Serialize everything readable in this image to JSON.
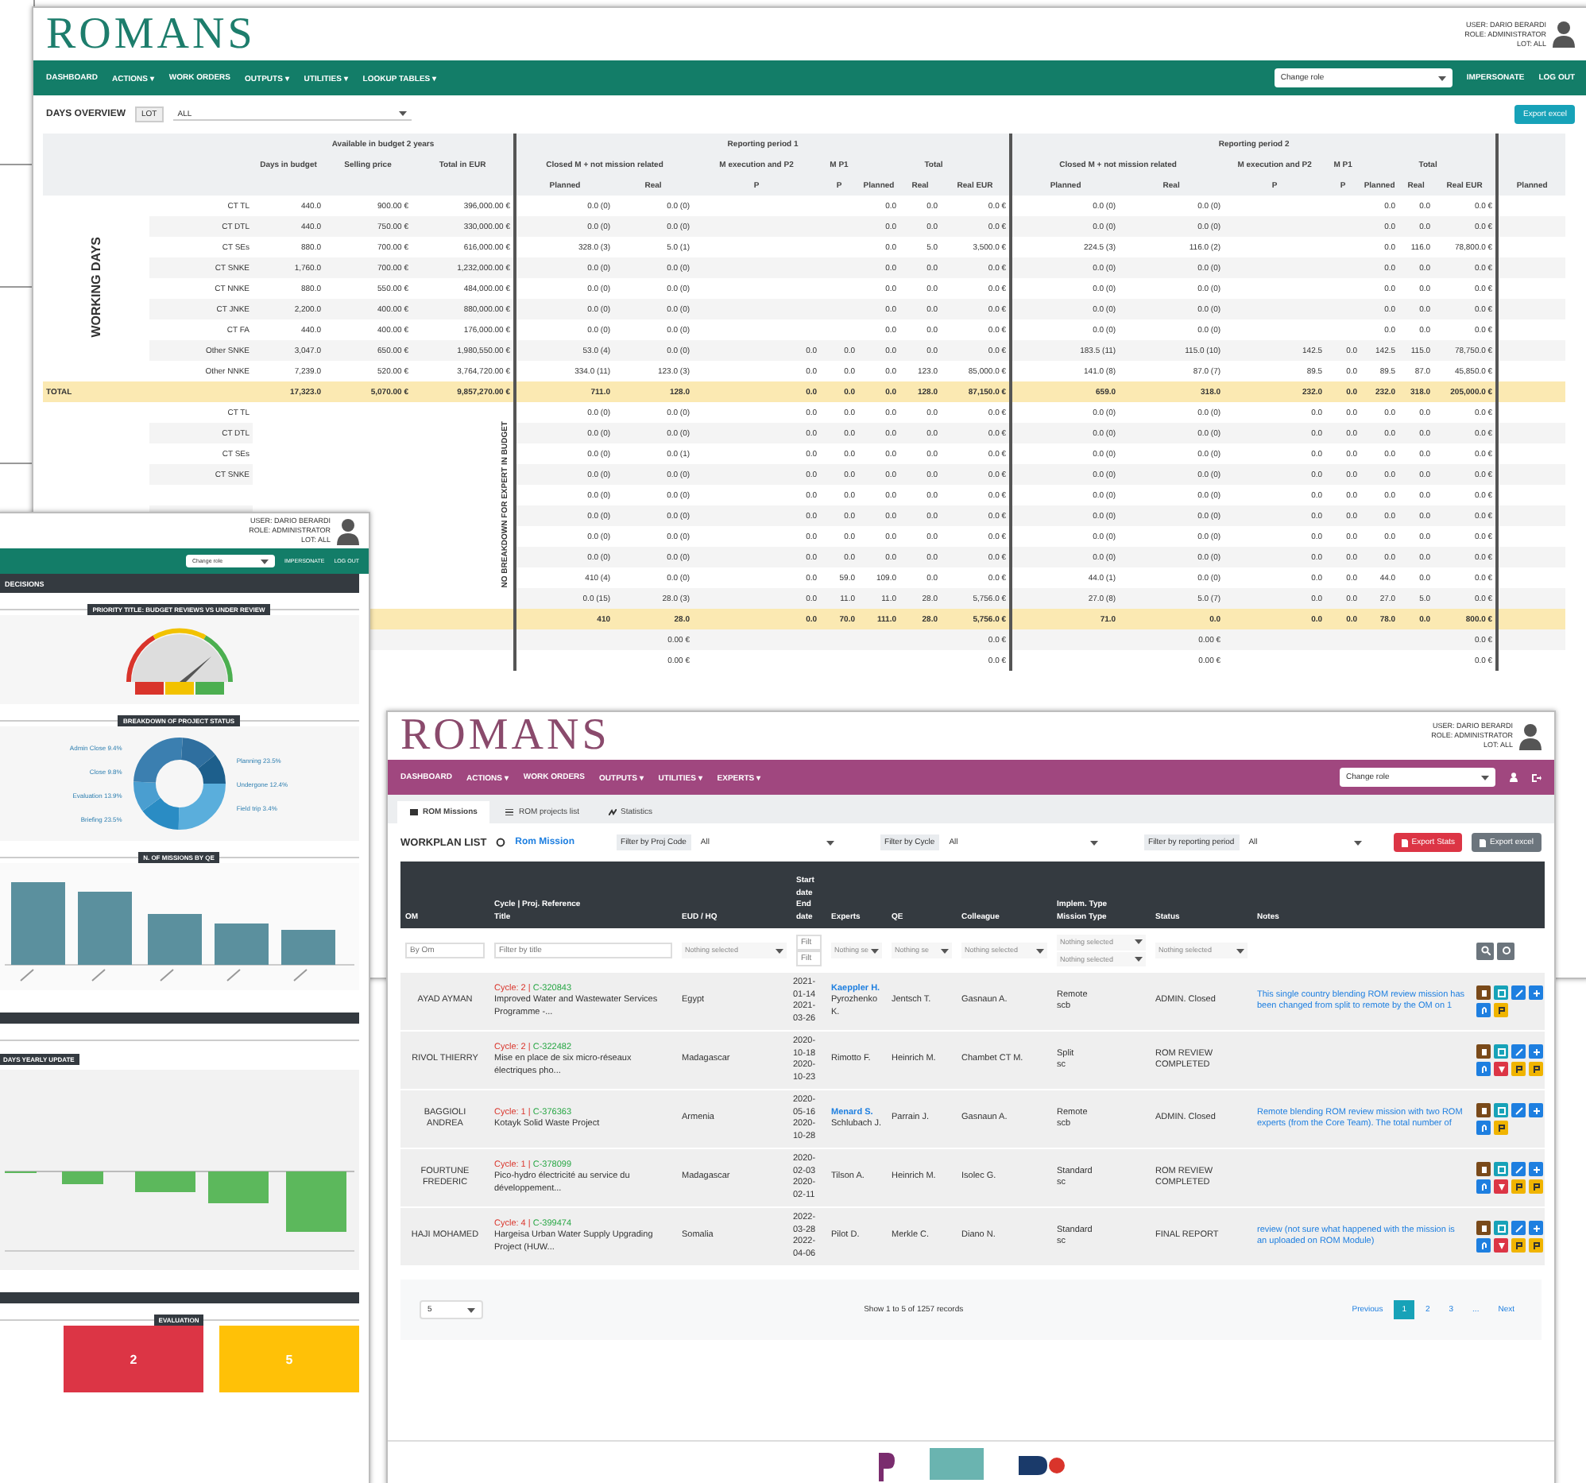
{
  "back_window": {
    "logo": "ROMANS",
    "user_info": [
      "USER: DARIO BERARDI",
      "ROLE: ADMINISTRATOR",
      "LOT: ALL"
    ],
    "nav": [
      "DASHBOARD",
      "ACTIONS ▾",
      "WORK ORDERS",
      "OUTPUTS ▾",
      "UTILITIES ▾",
      "LOOKUP TABLES ▾"
    ],
    "role_select": "Change role",
    "nav_links": [
      "IMPERSONATE",
      "LOG OUT"
    ],
    "page_title": "DAYS OVERVIEW",
    "lot_filter": {
      "label": "LOT",
      "value": "ALL"
    },
    "export_button": "Export excel",
    "table": {
      "budget_group": "Available in budget 2 years",
      "budget_columns": [
        "Days in budget",
        "Selling price",
        "Total in EUR"
      ],
      "periods": [
        {
          "title": "Reporting period 1",
          "subheaders": [
            "Closed M + not mission related",
            "M execution and P2",
            "M P1",
            "Total"
          ],
          "columns": [
            "Planned",
            "Real",
            "P",
            "P",
            "Planned",
            "Real",
            "Real EUR"
          ]
        },
        {
          "title": "Reporting period 2",
          "subheaders": [
            "Closed M + not mission related",
            "M execution and P2",
            "M P1",
            "Total"
          ],
          "columns": [
            "Planned",
            "Real",
            "P",
            "P",
            "Planned",
            "Real",
            "Real EUR"
          ]
        }
      ],
      "extra_column": "Planned",
      "sections": [
        {
          "title": "WORKING DAYS",
          "rows": [
            {
              "kind": "item",
              "label": "CT TL",
              "cells": [
                "440.0",
                "900.00 €",
                "396,000.00 €",
                "0.0 (0)",
                "0.0 (0)",
                null,
                null,
                "0.0",
                "0.0",
                "0.0 €",
                "0.0 (0)",
                "0.0 (0)",
                null,
                null,
                "0.0",
                "0.0",
                "0.0 €"
              ]
            },
            {
              "kind": "item",
              "label": "CT DTL",
              "cells": [
                "440.0",
                "750.00 €",
                "330,000.00 €",
                "0.0 (0)",
                "0.0 (0)",
                null,
                null,
                "0.0",
                "0.0",
                "0.0 €",
                "0.0 (0)",
                "0.0 (0)",
                null,
                null,
                "0.0",
                "0.0",
                "0.0 €"
              ]
            },
            {
              "kind": "item",
              "label": "CT SEs",
              "cells": [
                "880.0",
                "700.00 €",
                "616,000.00 €",
                "328.0 (3)",
                "5.0 (1)",
                null,
                null,
                "0.0",
                "5.0",
                "3,500.0 €",
                "224.5 (3)",
                "116.0 (2)",
                null,
                null,
                "0.0",
                "116.0",
                "78,800.0 €"
              ]
            },
            {
              "kind": "item",
              "label": "CT SNKE",
              "cells": [
                "1,760.0",
                "700.00 €",
                "1,232,000.00 €",
                "0.0 (0)",
                "0.0 (0)",
                null,
                null,
                "0.0",
                "0.0",
                "0.0 €",
                "0.0 (0)",
                "0.0 (0)",
                null,
                null,
                "0.0",
                "0.0",
                "0.0 €"
              ]
            },
            {
              "kind": "item",
              "label": "CT NNKE",
              "cells": [
                "880.0",
                "550.00 €",
                "484,000.00 €",
                "0.0 (0)",
                "0.0 (0)",
                null,
                null,
                "0.0",
                "0.0",
                "0.0 €",
                "0.0 (0)",
                "0.0 (0)",
                null,
                null,
                "0.0",
                "0.0",
                "0.0 €"
              ]
            },
            {
              "kind": "item",
              "label": "CT JNKE",
              "cells": [
                "2,200.0",
                "400.00 €",
                "880,000.00 €",
                "0.0 (0)",
                "0.0 (0)",
                null,
                null,
                "0.0",
                "0.0",
                "0.0 €",
                "0.0 (0)",
                "0.0 (0)",
                null,
                null,
                "0.0",
                "0.0",
                "0.0 €"
              ]
            },
            {
              "kind": "item",
              "label": "CT FA",
              "cells": [
                "440.0",
                "400.00 €",
                "176,000.00 €",
                "0.0 (0)",
                "0.0 (0)",
                null,
                null,
                "0.0",
                "0.0",
                "0.0 €",
                "0.0 (0)",
                "0.0 (0)",
                null,
                null,
                "0.0",
                "0.0",
                "0.0 €"
              ]
            },
            {
              "kind": "item",
              "label": "Other SNKE",
              "cells": [
                "3,047.0",
                "650.00 €",
                "1,980,550.00 €",
                "53.0 (4)",
                "0.0 (0)",
                "0.0",
                "0.0",
                "0.0",
                "0.0",
                "0.0 €",
                "183.5 (11)",
                "115.0 (10)",
                "142.5",
                "0.0",
                "142.5",
                "115.0",
                "78,750.0 €"
              ]
            },
            {
              "kind": "item",
              "label": "Other NNKE",
              "cells": [
                "7,239.0",
                "520.00 €",
                "3,764,720.00 €",
                "334.0 (11)",
                "123.0 (3)",
                "0.0",
                "0.0",
                "0.0",
                "123.0",
                "85,000.0 €",
                "141.0 (8)",
                "87.0 (7)",
                "89.5",
                "0.0",
                "89.5",
                "87.0",
                "45,850.0 €"
              ]
            },
            {
              "kind": "total",
              "label": "TOTAL",
              "cells": [
                "17,323.0",
                "5,070.00 €",
                "9,857,270.00 €",
                "711.0",
                "128.0",
                "0.0",
                "0.0",
                "0.0",
                "128.0",
                "87,150.0 €",
                "659.0",
                "318.0",
                "232.0",
                "0.0",
                "232.0",
                "318.0",
                "205,000.0 €"
              ]
            }
          ]
        },
        {
          "title": "NO BREAKDOWN FOR EXPERT IN BUDGET",
          "rows": [
            {
              "kind": "item",
              "label": "CT TL",
              "cells": [
                null,
                null,
                null,
                "0.0 (0)",
                "0.0 (0)",
                "0.0",
                "0.0",
                "0.0",
                "0.0",
                "0.0 €",
                "0.0 (0)",
                "0.0 (0)",
                "0.0",
                "0.0",
                "0.0",
                "0.0",
                "0.0 €"
              ]
            },
            {
              "kind": "item",
              "label": "CT DTL",
              "cells": [
                null,
                null,
                null,
                "0.0 (0)",
                "0.0 (0)",
                "0.0",
                "0.0",
                "0.0",
                "0.0",
                "0.0 €",
                "0.0 (0)",
                "0.0 (0)",
                "0.0",
                "0.0",
                "0.0",
                "0.0",
                "0.0 €"
              ]
            },
            {
              "kind": "item",
              "label": "CT SEs",
              "cells": [
                null,
                null,
                null,
                "0.0 (0)",
                "0.0 (1)",
                "0.0",
                "0.0",
                "0.0",
                "0.0",
                "0.0 €",
                "0.0 (0)",
                "0.0 (0)",
                "0.0",
                "0.0",
                "0.0",
                "0.0",
                "0.0 €"
              ]
            },
            {
              "kind": "item",
              "label": "CT SNKE",
              "cells": [
                null,
                null,
                null,
                "0.0 (0)",
                "0.0 (0)",
                "0.0",
                "0.0",
                "0.0",
                "0.0",
                "0.0 €",
                "0.0 (0)",
                "0.0 (0)",
                "0.0",
                "0.0",
                "0.0",
                "0.0",
                "0.0 €"
              ]
            },
            {
              "kind": "item",
              "cells": [
                null,
                null,
                null,
                "0.0 (0)",
                "0.0 (0)",
                "0.0",
                "0.0",
                "0.0",
                "0.0",
                "0.0 €",
                "0.0 (0)",
                "0.0 (0)",
                "0.0",
                "0.0",
                "0.0",
                "0.0",
                "0.0 €"
              ]
            },
            {
              "kind": "item",
              "cells": [
                null,
                null,
                null,
                "0.0 (0)",
                "0.0 (0)",
                "0.0",
                "0.0",
                "0.0",
                "0.0",
                "0.0 €",
                "0.0 (0)",
                "0.0 (0)",
                "0.0",
                "0.0",
                "0.0",
                "0.0",
                "0.0 €"
              ]
            },
            {
              "kind": "item",
              "cells": [
                null,
                null,
                null,
                "0.0 (0)",
                "0.0 (0)",
                "0.0",
                "0.0",
                "0.0",
                "0.0",
                "0.0 €",
                "0.0 (0)",
                "0.0 (0)",
                "0.0",
                "0.0",
                "0.0",
                "0.0",
                "0.0 €"
              ]
            },
            {
              "kind": "item",
              "cells": [
                null,
                null,
                null,
                "0.0 (0)",
                "0.0 (0)",
                "0.0",
                "0.0",
                "0.0",
                "0.0",
                "0.0 €",
                "0.0 (0)",
                "0.0 (0)",
                "0.0",
                "0.0",
                "0.0",
                "0.0",
                "0.0 €"
              ]
            },
            {
              "kind": "item",
              "cells": [
                null,
                null,
                null,
                "410 (4)",
                "0.0 (0)",
                "0.0",
                "59.0",
                "109.0",
                "0.0",
                "0.0 €",
                "44.0 (1)",
                "0.0 (0)",
                "0.0",
                "0.0",
                "44.0",
                "0.0",
                "0.0 €"
              ]
            },
            {
              "kind": "item",
              "cells": [
                null,
                null,
                null,
                "0.0 (15)",
                "28.0 (3)",
                "0.0",
                "11.0",
                "11.0",
                "28.0",
                "5,756.0 €",
                "27.0 (8)",
                "5.0 (7)",
                "0.0",
                "0.0",
                "27.0",
                "5.0",
                "0.0 €"
              ]
            },
            {
              "kind": "total",
              "cells": [
                null,
                null,
                null,
                "410",
                "28.0",
                "0.0",
                "70.0",
                "111.0",
                "28.0",
                "5,756.0 €",
                "71.0",
                "0.0",
                "0.0",
                "0.0",
                "78.0",
                "0.0",
                "800.0 €"
              ]
            },
            {
              "kind": "item",
              "cells": [
                null,
                null,
                null,
                null,
                "0.00 €",
                null,
                null,
                null,
                null,
                "0.0 €",
                null,
                "0.00 €",
                null,
                null,
                null,
                null,
                "0.0 €"
              ]
            },
            {
              "kind": "item",
              "cells": [
                null,
                null,
                null,
                null,
                "0.00 €",
                null,
                null,
                null,
                null,
                "0.0 €",
                null,
                "0.00 €",
                null,
                null,
                null,
                null,
                "0.0 €"
              ]
            }
          ]
        }
      ]
    }
  },
  "dashboard_window": {
    "user_info": [
      "USER: DARIO BERARDI",
      "ROLE: ADMINISTRATOR",
      "LOT: ALL"
    ],
    "role_select": "Change role",
    "nav_links": [
      "IMPERSONATE",
      "LOG OUT"
    ],
    "section_bar": "DECISIONS",
    "panels": [
      {
        "kind": "gauge",
        "title": "PRIORITY TITLE: BUDGET REVIEWS VS UNDER REVIEW"
      },
      {
        "kind": "donut",
        "title": "BREAKDOWN OF PROJECT STATUS",
        "labels_left": [
          "Admin Close 9.4%",
          "Close 9.8%",
          "Evaluation 13.9%",
          "Briefing 23.5%"
        ],
        "labels_right": [
          "Planning 23.5%",
          "Undergone 12.4%",
          "Field trip 3.4%"
        ]
      },
      {
        "kind": "bars",
        "title": "N. OF MISSIONS BY QE"
      },
      {
        "kind": "heading_bar"
      },
      {
        "kind": "negative_bars",
        "title": "DAYS YEARLY UPDATE"
      },
      {
        "kind": "heading_bar"
      },
      {
        "kind": "cards",
        "title": "EVALUATION",
        "cards": [
          {
            "value": "2",
            "color": "#dc3545"
          },
          {
            "value": "5",
            "color": "#ffc107"
          }
        ]
      }
    ]
  },
  "front_window": {
    "logo": "ROMANS",
    "user_info": [
      "USER: DARIO BERARDI",
      "ROLE: ADMINISTRATOR",
      "LOT: ALL"
    ],
    "nav": [
      "DASHBOARD",
      "ACTIONS ▾",
      "WORK ORDERS",
      "OUTPUTS ▾",
      "UTILITIES ▾",
      "EXPERTS ▾"
    ],
    "role_select": "Change role",
    "tabs": [
      {
        "label": "ROM Missions",
        "selected": true
      },
      {
        "label": "ROM projects list",
        "selected": false
      },
      {
        "label": "Statistics",
        "selected": false
      }
    ],
    "list_title": "WORKPLAN LIST",
    "list_link": "Rom Mission",
    "filters": [
      {
        "label": "Filter by Proj Code",
        "value": "All"
      },
      {
        "label": "Filter by Cycle",
        "value": "All"
      },
      {
        "label": "Filter by reporting period",
        "value": "All"
      }
    ],
    "buttons": [
      {
        "label": "Export Stats",
        "kind": "danger"
      },
      {
        "label": "Export excel",
        "kind": "secondary"
      }
    ],
    "columns": [
      [
        "OM"
      ],
      [
        "Cycle | Proj. Reference",
        "Title"
      ],
      [
        "EUD / HQ"
      ],
      [
        "Start",
        "date",
        "End",
        "date"
      ],
      [
        "Experts"
      ],
      [
        "QE"
      ],
      [
        "Colleague"
      ],
      [
        "Implem. Type",
        "Mission Type"
      ],
      [
        "Status"
      ],
      [
        "Notes"
      ]
    ],
    "filter_row": [
      [
        {
          "kind": "input",
          "placeholder": "By Om"
        }
      ],
      [
        {
          "kind": "input",
          "placeholder": "Filter by title"
        }
      ],
      [
        {
          "kind": "select",
          "placeholder": "Nothing selected"
        }
      ],
      [
        {
          "kind": "input",
          "placeholder": "Filt"
        },
        {
          "kind": "input",
          "placeholder": "Filt"
        }
      ],
      [
        {
          "kind": "select",
          "placeholder": "Nothing se"
        }
      ],
      [
        {
          "kind": "select",
          "placeholder": "Nothing se"
        }
      ],
      [
        {
          "kind": "select",
          "placeholder": "Nothing selected"
        }
      ],
      [
        {
          "kind": "select",
          "placeholder": "Nothing selected"
        },
        {
          "kind": "select",
          "placeholder": "Nothing selected"
        }
      ],
      [
        {
          "kind": "select",
          "placeholder": "Nothing selected"
        }
      ]
    ],
    "rows": [
      {
        "om": "AYAD AYMAN",
        "cycle": "Cycle: 2 |",
        "reference": "C-320843",
        "title": "Improved Water and Wastewater Services Programme -...",
        "eud": "Egypt",
        "dates": "2021-01-14 2021-03-26",
        "experts": [
          {
            "name": "Kaeppler H.",
            "link": true
          },
          {
            "name": "Pyrozhenko K.",
            "link": false
          }
        ],
        "qe": "Jentsch T.",
        "colleague": "Gasnaun A.",
        "implem_type": "Remote",
        "mission_type": "scb",
        "status": "ADMIN. Closed",
        "notes": "This single country blending ROM review mission has been changed from split to remote by the OM on 1",
        "actions": [
          {
            "kind": "doc"
          },
          {
            "kind": "view"
          },
          {
            "kind": "edit"
          },
          {
            "kind": "add"
          },
          {
            "kind": "attach"
          },
          {
            "kind": "flag"
          }
        ]
      },
      {
        "om": "RIVOL THIERRY",
        "cycle": "Cycle: 2 |",
        "reference": "C-322482",
        "title": "Mise en place de six micro-réseaux électriques pho...",
        "eud": "Madagascar",
        "dates": "2020-10-18 2020-10-23",
        "experts": [
          {
            "name": "Rimotto F.",
            "link": false
          }
        ],
        "qe": "Heinrich M.",
        "colleague": "Chambet CT M.",
        "implem_type": "Split",
        "mission_type": "sc",
        "status": "ROM REVIEW COMPLETED",
        "actions": [
          {
            "kind": "doc"
          },
          {
            "kind": "view"
          },
          {
            "kind": "edit"
          },
          {
            "kind": "add"
          },
          {
            "kind": "attach"
          },
          {
            "kind": "pdf"
          },
          {
            "kind": "flag"
          },
          {
            "kind": "flag"
          }
        ]
      },
      {
        "om": "BAGGIOLI ANDREA",
        "cycle": "Cycle: 1 |",
        "reference": "C-376363",
        "title": "Kotayk Solid Waste Project",
        "eud": "Armenia",
        "dates": "2020-05-16 2020-10-28",
        "experts": [
          {
            "name": "Menard S.",
            "link": true
          },
          {
            "name": "Schlubach J.",
            "link": false
          }
        ],
        "qe": "Parrain J.",
        "colleague": "Gasnaun A.",
        "implem_type": "Remote",
        "mission_type": "scb",
        "status": "ADMIN. Closed",
        "notes": "Remote blending ROM review mission with two ROM experts (from the Core Team). The total number of",
        "actions": [
          {
            "kind": "doc"
          },
          {
            "kind": "view"
          },
          {
            "kind": "edit"
          },
          {
            "kind": "add"
          },
          {
            "kind": "attach"
          },
          {
            "kind": "flag"
          }
        ]
      },
      {
        "om": "FOURTUNE FREDERIC",
        "cycle": "Cycle: 1 |",
        "reference": "C-378099",
        "title": "Pico-hydro électricité au service du développement...",
        "eud": "Madagascar",
        "dates": "2020-02-03 2020-02-11",
        "experts": [
          {
            "name": "Tilson A.",
            "link": false
          }
        ],
        "qe": "Heinrich M.",
        "colleague": "Isolec G.",
        "implem_type": "Standard",
        "mission_type": "sc",
        "status": "ROM REVIEW COMPLETED",
        "actions": [
          {
            "kind": "doc"
          },
          {
            "kind": "view"
          },
          {
            "kind": "edit"
          },
          {
            "kind": "add"
          },
          {
            "kind": "attach"
          },
          {
            "kind": "pdf"
          },
          {
            "kind": "flag"
          },
          {
            "kind": "flag"
          }
        ]
      },
      {
        "om": "HAJI MOHAMED",
        "cycle": "Cycle: 4 |",
        "reference": "C-399474",
        "title": "Hargeisa Urban Water Supply Upgrading Project (HUW...",
        "eud": "Somalia",
        "dates": "2022-03-28 2022-04-06",
        "experts": [
          {
            "name": "Pilot D.",
            "link": false
          }
        ],
        "qe": "Merkle C.",
        "colleague": "Diano N.",
        "implem_type": "Standard",
        "mission_type": "sc",
        "status": "FINAL REPORT",
        "notes": "review (not sure what happened with the mission is an uploaded on ROM Module)",
        "actions": [
          {
            "kind": "doc"
          },
          {
            "kind": "view"
          },
          {
            "kind": "edit"
          },
          {
            "kind": "add"
          },
          {
            "kind": "attach"
          },
          {
            "kind": "pdf"
          },
          {
            "kind": "flag"
          },
          {
            "kind": "flag"
          }
        ]
      }
    ],
    "page_size": "5",
    "summary": "Show 1 to 5 of 1257 records",
    "pagination": [
      {
        "label": "Previous",
        "selected": false
      },
      {
        "label": "1",
        "selected": true
      },
      {
        "label": "2",
        "selected": false
      },
      {
        "label": "3",
        "selected": false
      },
      {
        "label": "...",
        "selected": false
      },
      {
        "label": "Next",
        "selected": false
      }
    ]
  }
}
